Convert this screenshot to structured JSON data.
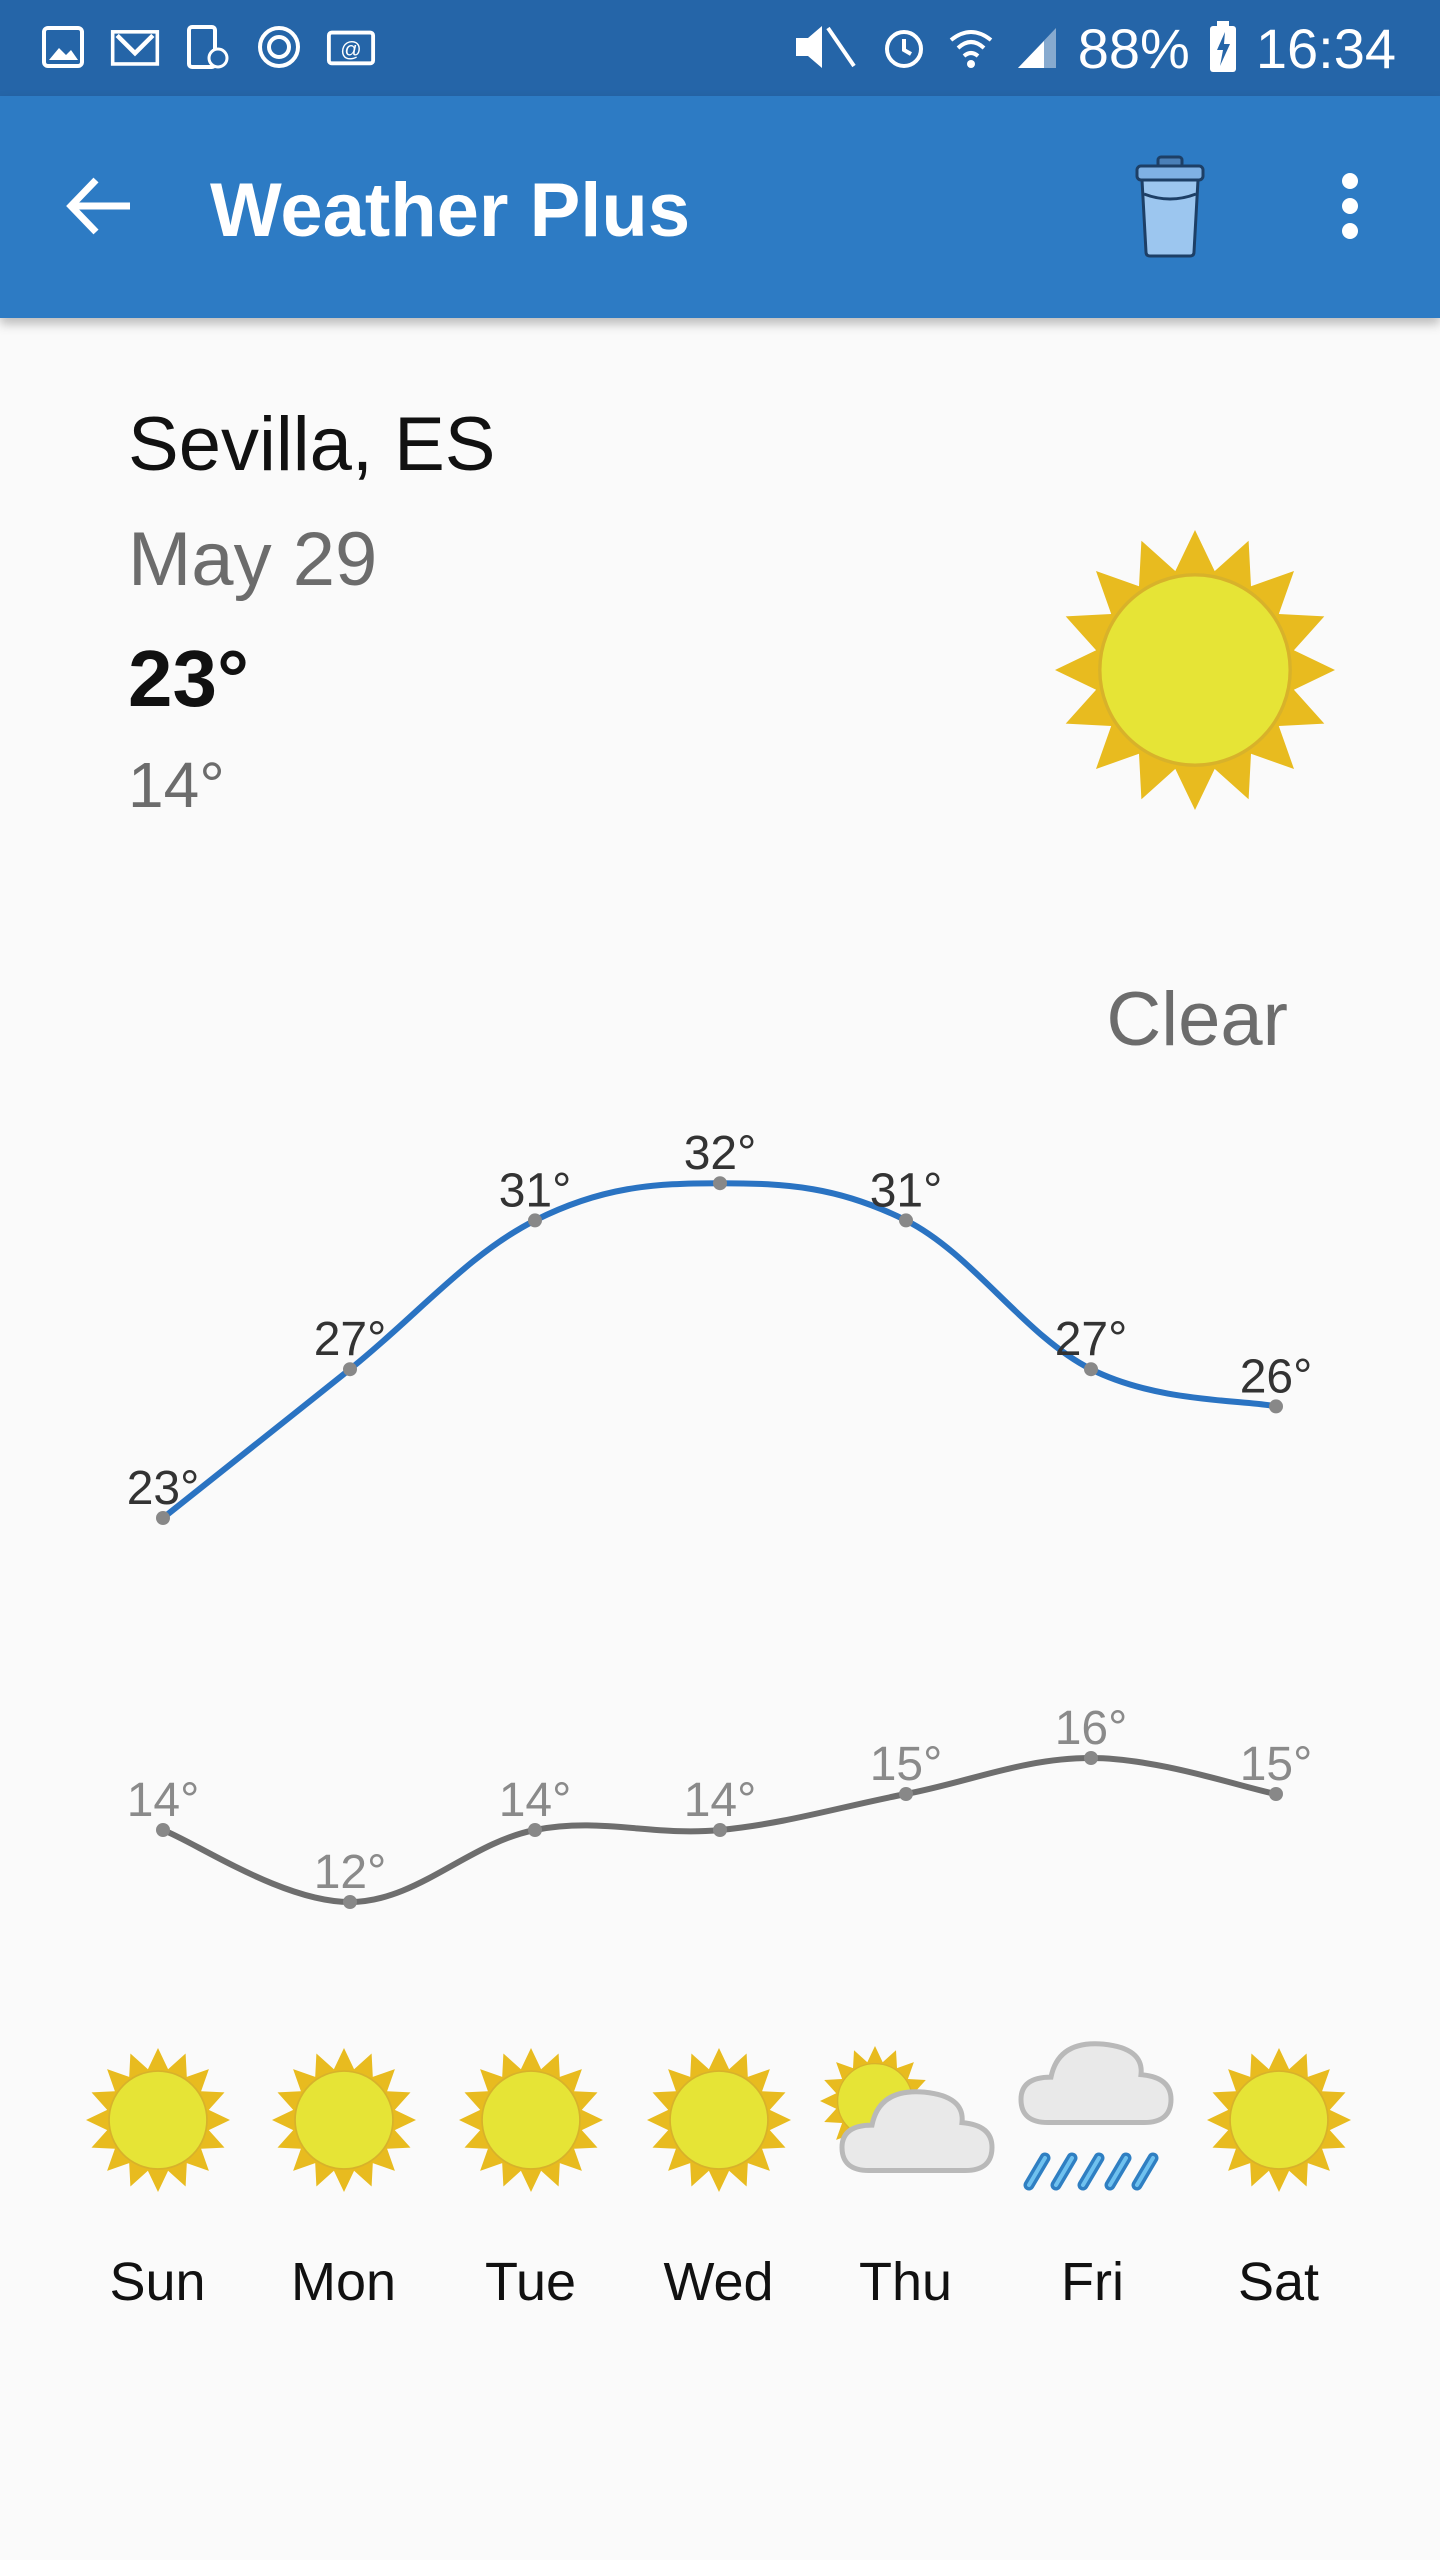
{
  "status_bar": {
    "left_icons": [
      "gallery-icon",
      "mail-icon",
      "device-icon",
      "sync-icon",
      "email-at-icon"
    ],
    "right_icons": [
      "mute-icon",
      "alarm-icon",
      "wifi-icon",
      "signal-icon"
    ],
    "battery": "88%",
    "time": "16:34"
  },
  "app_bar": {
    "title": "Weather Plus",
    "back_icon": "arrow-left-icon",
    "trash_icon": "trash-icon",
    "more_icon": "more-vert-icon"
  },
  "current": {
    "city": "Sevilla, ES",
    "date": "May 29",
    "high": "23°",
    "low": "14°",
    "condition": "Clear",
    "icon": "sun-icon"
  },
  "colors": {
    "status_bar": "#2565a8",
    "app_bar": "#2d7bc4",
    "high_line": "#2a73c2",
    "low_line": "#6e6e6e",
    "point": "#888888"
  },
  "chart_data": {
    "type": "line",
    "categories": [
      "Sun",
      "Mon",
      "Tue",
      "Wed",
      "Thu",
      "Fri",
      "Sat"
    ],
    "series": [
      {
        "values": [
          23,
          27,
          31,
          32,
          31,
          27,
          26
        ],
        "labels": [
          "23°",
          "27°",
          "31°",
          "32°",
          "31°",
          "27°",
          "26°"
        ]
      },
      {
        "values": [
          14,
          12,
          14,
          14,
          15,
          16,
          15
        ],
        "labels": [
          "14°",
          "12°",
          "14°",
          "14°",
          "15°",
          "16°",
          "15°"
        ]
      }
    ]
  },
  "forecast": [
    {
      "day": "Sun",
      "icon": "sun-icon"
    },
    {
      "day": "Mon",
      "icon": "sun-icon"
    },
    {
      "day": "Tue",
      "icon": "sun-icon"
    },
    {
      "day": "Wed",
      "icon": "sun-icon"
    },
    {
      "day": "Thu",
      "icon": "partly-cloudy-icon"
    },
    {
      "day": "Fri",
      "icon": "rain-icon"
    },
    {
      "day": "Sat",
      "icon": "sun-icon"
    }
  ]
}
